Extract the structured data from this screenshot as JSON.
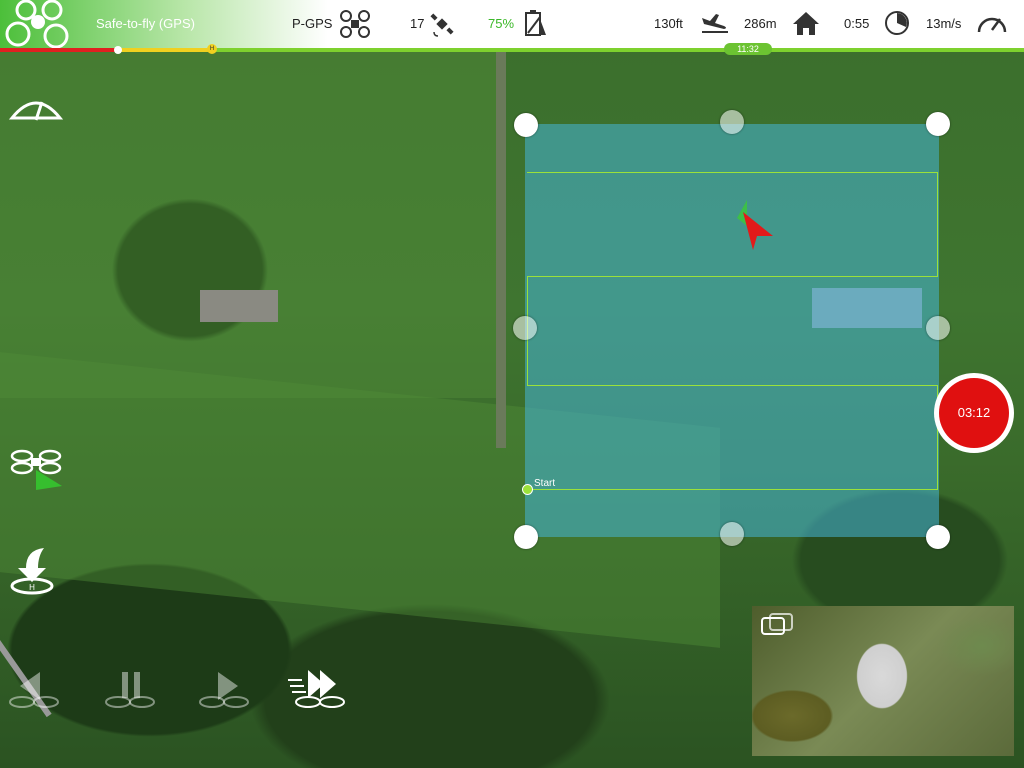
{
  "status_bar": {
    "safe_label": "Safe-to-fly (GPS)",
    "mode": "P-GPS",
    "satellites": "17",
    "battery": "75%",
    "altitude": "130ft",
    "distance": "286m",
    "flight_time": "0:55",
    "speed": "13m/s"
  },
  "timeline": {
    "time_label": "11:32",
    "marker_label": "H"
  },
  "map": {
    "start_label": "Start"
  },
  "record": {
    "time": "03:12"
  },
  "colors": {
    "accent_green": "#7ed12e",
    "record_red": "#e01010",
    "mission_area": "#46b4d7"
  }
}
